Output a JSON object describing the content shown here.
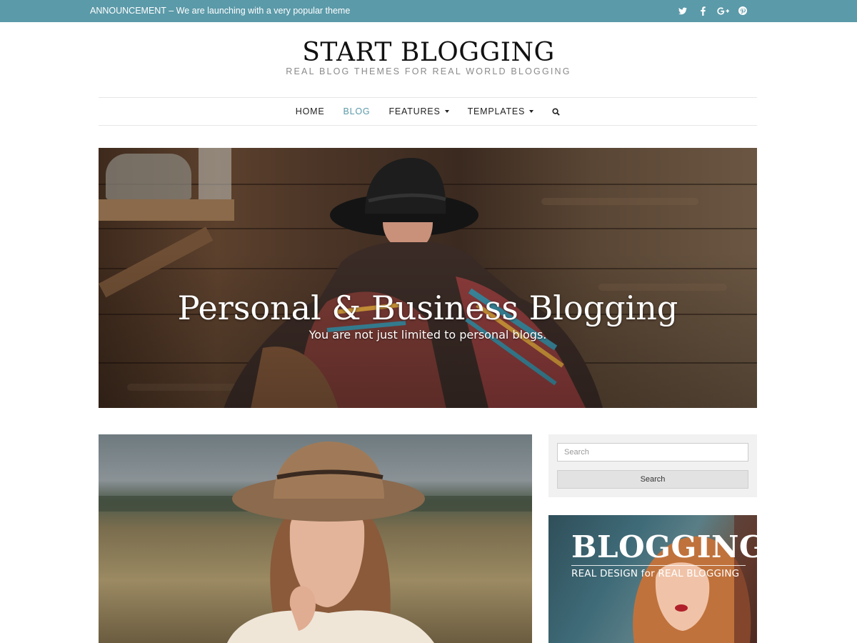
{
  "topbar": {
    "announcement": "ANNOUNCEMENT – We are launching with a very popular theme",
    "socials": [
      "twitter-icon",
      "facebook-icon",
      "google-plus-icon",
      "pinterest-icon"
    ],
    "bg_color": "#5b9aa9"
  },
  "header": {
    "title": "START BLOGGING",
    "tagline": "REAL BLOG THEMES FOR REAL WORLD BLOGGING"
  },
  "nav": {
    "items": [
      {
        "label": "HOME",
        "active": false,
        "dropdown": false
      },
      {
        "label": "BLOG",
        "active": true,
        "dropdown": false
      },
      {
        "label": "FEATURES",
        "active": false,
        "dropdown": true
      },
      {
        "label": "TEMPLATES",
        "active": false,
        "dropdown": true
      }
    ],
    "search_icon": "search-icon",
    "accent_color": "#5b9aa9"
  },
  "hero": {
    "title": "Personal & Business Blogging",
    "subtitle": "You are not just limited to personal blogs."
  },
  "sidebar": {
    "search": {
      "placeholder": "Search",
      "button_label": "Search"
    },
    "banner": {
      "title": "BLOGGING",
      "subtitle": "REAL DESIGN for REAL BLOGGING"
    }
  }
}
